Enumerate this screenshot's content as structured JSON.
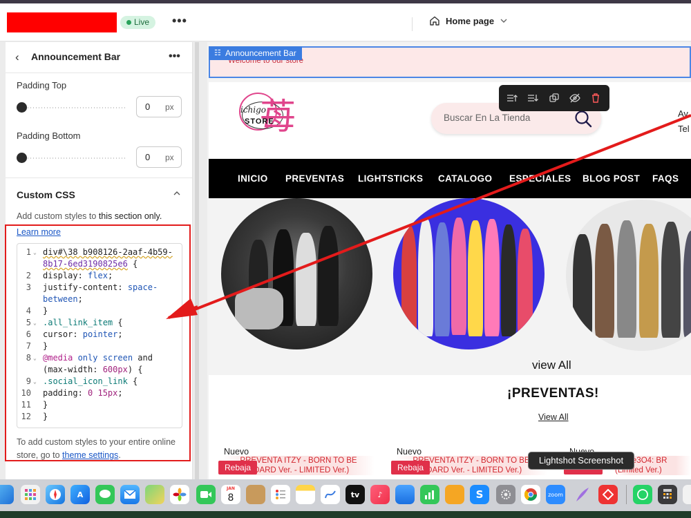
{
  "topbar": {
    "live_badge": "Live",
    "more": "•••",
    "page_selector": "Home page"
  },
  "panel": {
    "title": "Announcement Bar",
    "more": "•••",
    "padding_top": {
      "label": "Padding Top",
      "value": "0",
      "unit": "px",
      "level": 0
    },
    "padding_bottom": {
      "label": "Padding Bottom",
      "value": "0",
      "unit": "px",
      "level": 0
    },
    "custom_css": {
      "heading": "Custom CSS",
      "desc_prefix": "Add custom styles to ",
      "desc_bold": "this section only.",
      "learn_more": "Learn more",
      "footer_prefix": "To add custom styles to your entire online store, go to ",
      "footer_link": "theme settings",
      "footer_suffix": "."
    },
    "code": {
      "n1": "1",
      "n2": "2",
      "n3": "3",
      "n4": "4",
      "n5": "5",
      "n6": "6",
      "n7": "7",
      "n8": "8",
      "n9": "9",
      "n10": "10",
      "n11": "11",
      "n12": "12",
      "fold": "⌄",
      "l1a": "div#\\38 b908126-2aaf-4b59-",
      "l1b": "8b17-6ed3190825e6",
      "l1c": " {",
      "l2a": "  display: ",
      "l2b": "flex",
      "l2c": ";",
      "l3a": "  justify-content: ",
      "l3b": "space-",
      "l3d": "between",
      "l3e": ";",
      "l4": "}",
      "l5a": ".all_link_item",
      "l5b": " {",
      "l6a": "  cursor: ",
      "l6b": "pointer",
      "l6c": ";",
      "l7": "}",
      "l8a": "@media",
      "l8b": " only screen ",
      "l8c": "and",
      "l8d": "(max-width: ",
      "l8e": "600px",
      "l8f": ") {",
      "l9a": "  .social_icon_link",
      "l9b": " {",
      "l10a": "    padding: ",
      "l10b": "0 15px",
      "l10c": ";",
      "l11": "  }",
      "l12": "}"
    }
  },
  "preview": {
    "announcement_tag": "Announcement Bar",
    "announcement_text": "Welcome to our store",
    "logo_text1": "ichigo",
    "logo_text2": "STORE",
    "logo_kanji": "苺",
    "search_placeholder": "Buscar En La Tienda",
    "header_right1": "Av",
    "header_right2": "Tel",
    "nav": [
      "INICIO",
      "PREVENTAS",
      "LIGHTSTICKS",
      "CATALOGO",
      "ESPECIALES",
      "BLOG POST",
      "FAQS"
    ],
    "view_all": "view All",
    "preventas_title": "¡PREVENTAS!",
    "preventas_link": "View All",
    "products": [
      {
        "tag": "Nuevo",
        "name1": "PREVENTA ITZY - BORN TO BE",
        "name2": "NDARD Ver. - LIMITED Ver.)",
        "badge": "Rebaja"
      },
      {
        "tag": "Nuevo",
        "name1": "PREVENTA ITZY - BORN TO BE",
        "name2": "NDARD Ver. - LIMITED Ver.)",
        "badge": "Rebaja"
      },
      {
        "tag": "Nuevo",
        "name1": "X - Fe3O4: BR",
        "name2": "(Limited Ver.)",
        "badge": ""
      }
    ]
  },
  "tooltip": "Lightshot Screenshot",
  "dock": {
    "calendar_month": "JAN",
    "calendar_day": "8",
    "zoom_label": "zoom",
    "tv_label": "tv",
    "s_label": "S"
  },
  "colors": {
    "accent_red": "#e21b1b",
    "live_green": "#29a35a",
    "selection_blue": "#3b7ce0",
    "rebaja": "#e0304a"
  }
}
